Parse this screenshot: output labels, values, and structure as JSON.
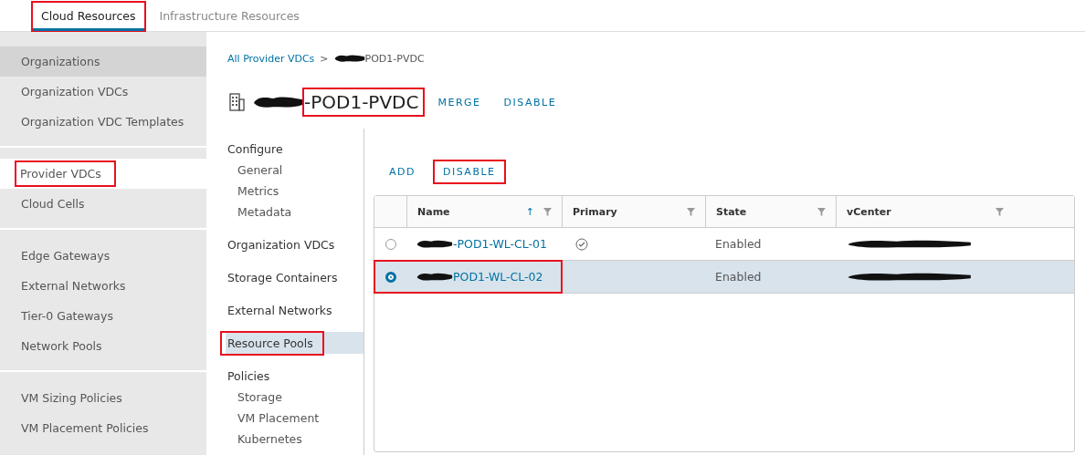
{
  "top_tabs": [
    {
      "label": "Cloud Resources",
      "selected": true,
      "annotated": true
    },
    {
      "label": "Infrastructure Resources",
      "selected": false,
      "annotated": false
    }
  ],
  "sidebar": {
    "groups": [
      {
        "items": [
          {
            "label": "Organizations",
            "selected": false,
            "hovered": true,
            "annotated": false
          },
          {
            "label": "Organization VDCs",
            "selected": false,
            "hovered": false,
            "annotated": false
          },
          {
            "label": "Organization VDC Templates",
            "selected": false,
            "hovered": false,
            "annotated": false
          }
        ]
      },
      {
        "items": [
          {
            "label": "Provider VDCs",
            "selected": true,
            "hovered": false,
            "annotated": true
          },
          {
            "label": "Cloud Cells",
            "selected": false,
            "hovered": false,
            "annotated": false
          }
        ]
      },
      {
        "items": [
          {
            "label": "Edge Gateways",
            "selected": false,
            "hovered": false,
            "annotated": false
          },
          {
            "label": "External Networks",
            "selected": false,
            "hovered": false,
            "annotated": false
          },
          {
            "label": "Tier-0 Gateways",
            "selected": false,
            "hovered": false,
            "annotated": false
          },
          {
            "label": "Network Pools",
            "selected": false,
            "hovered": false,
            "annotated": false
          }
        ]
      },
      {
        "items": [
          {
            "label": "VM Sizing Policies",
            "selected": false,
            "hovered": false,
            "annotated": false
          },
          {
            "label": "VM Placement Policies",
            "selected": false,
            "hovered": false,
            "annotated": false
          }
        ]
      }
    ]
  },
  "breadcrumb": {
    "link": "All Provider VDCs",
    "separator": ">",
    "current": "POD1-PVDC"
  },
  "header": {
    "title": "-POD1-PVDC",
    "annotated": true,
    "actions": [
      {
        "label": "MERGE"
      },
      {
        "label": "DISABLE"
      }
    ]
  },
  "section_nav": [
    {
      "label": "Configure",
      "selected": false,
      "annotated": false,
      "children": [
        {
          "label": "General"
        },
        {
          "label": "Metrics"
        },
        {
          "label": "Metadata"
        }
      ]
    },
    {
      "label": "Organization VDCs",
      "selected": false,
      "annotated": false
    },
    {
      "label": "Storage Containers",
      "selected": false,
      "annotated": false
    },
    {
      "label": "External Networks",
      "selected": false,
      "annotated": false
    },
    {
      "label": "Resource Pools",
      "selected": true,
      "annotated": true
    },
    {
      "label": "Policies",
      "selected": false,
      "annotated": false,
      "children": [
        {
          "label": "Storage"
        },
        {
          "label": "VM Placement"
        },
        {
          "label": "Kubernetes"
        }
      ]
    }
  ],
  "toolbar": [
    {
      "label": "ADD",
      "annotated": false
    },
    {
      "label": "DISABLE",
      "annotated": true
    }
  ],
  "table": {
    "columns": [
      {
        "label": "Name",
        "sort": "↑"
      },
      {
        "label": "Primary"
      },
      {
        "label": "State"
      },
      {
        "label": "vCenter"
      }
    ],
    "rows": [
      {
        "name": "-POD1-WL-CL-01",
        "primary": true,
        "state": "Enabled",
        "selected": false,
        "annotated": false
      },
      {
        "name": "POD1-WL-CL-02",
        "primary": false,
        "state": "Enabled",
        "selected": true,
        "annotated": true
      }
    ]
  }
}
